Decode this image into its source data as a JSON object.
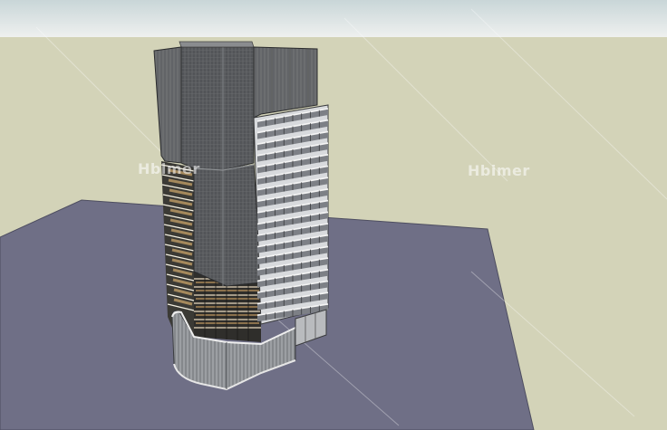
{
  "scene": {
    "sky_color": "#e9ebeb",
    "ground_color": "#d3d3b8",
    "site_plane_color": "#6f6f86"
  },
  "watermarks": {
    "left": "Hbimer",
    "right": "Hbimer"
  }
}
